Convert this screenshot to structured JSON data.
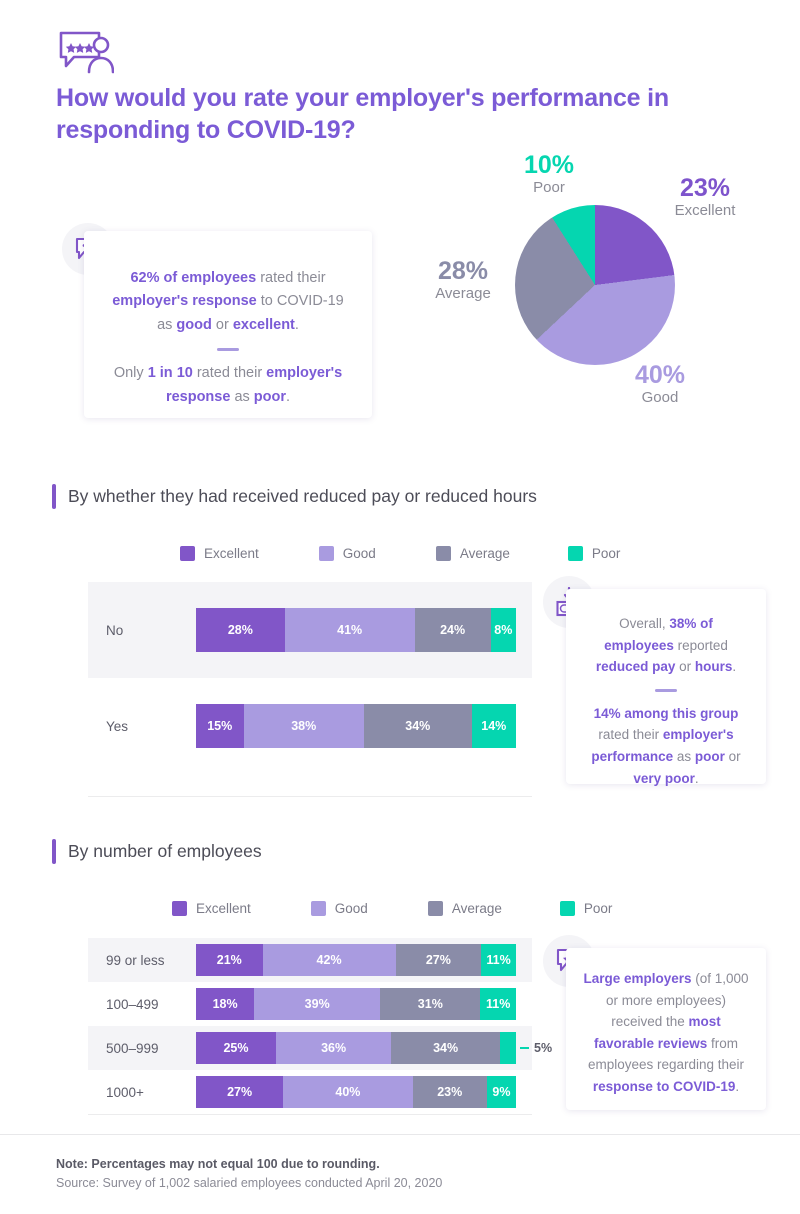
{
  "header": {
    "icon": "review-person-speech-bubble-icon",
    "title": "How would you rate your employer's performance in responding to COVID-19?"
  },
  "colors": {
    "excellent": "#8156c8",
    "good": "#a99be0",
    "average": "#8a8ca8",
    "poor": "#05d6b0",
    "title_purple": "#7b5bd6",
    "text_gray": "#8b8b96",
    "row_alt": "#f4f4f7"
  },
  "pie_labels": {
    "poor": {
      "value": "10%",
      "label": "Poor"
    },
    "excellent": {
      "value": "23%",
      "label": "Excellent"
    },
    "average": {
      "value": "28%",
      "label": "Average"
    },
    "good": {
      "value": "40%",
      "label": "Good"
    }
  },
  "cards": {
    "card1": {
      "icon": "speech-bubble-dots-icon",
      "line1_a": "62% of employees",
      "line1_b": " rated their ",
      "line1_c": "employer's response",
      "line1_d": " to COVID-19 as ",
      "line1_e": "good",
      "line1_f": " or ",
      "line1_g": "excellent",
      "line1_h": ".",
      "line2_a": "Only ",
      "line2_b": "1 in 10",
      "line2_c": " rated their ",
      "line2_d": "employer's response",
      "line2_e": " as ",
      "line2_f": "poor",
      "line2_g": "."
    },
    "card2": {
      "icon": "money-reduced-pay-icon",
      "line1_a": "Overall, ",
      "line1_b": "38% of employees",
      "line1_c": " reported ",
      "line1_d": "reduced pay",
      "line1_e": " or ",
      "line1_f": "hours",
      "line1_g": ".",
      "line2_a": "14% among this group",
      "line2_b": " rated their ",
      "line2_c": "employer's performance",
      "line2_d": " as ",
      "line2_e": "poor",
      "line2_f": " or ",
      "line2_g": "very poor",
      "line2_h": "."
    },
    "card3": {
      "icon": "star-speech-bubble-icon",
      "line1_a": "Large employers",
      "line1_b": " (of 1,000 or more employees) received the ",
      "line1_c": "most favorable reviews",
      "line1_d": " from employees regarding their ",
      "line1_e": "response to COVID-19",
      "line1_f": "."
    }
  },
  "sections": {
    "section1_title": "By whether they had received reduced pay or reduced hours",
    "section2_title": "By number of employees"
  },
  "legend": [
    {
      "label": "Excellent",
      "color": "#8156c8"
    },
    {
      "label": "Good",
      "color": "#a99be0"
    },
    {
      "label": "Average",
      "color": "#8a8ca8"
    },
    {
      "label": "Poor",
      "color": "#05d6b0"
    }
  ],
  "footer": {
    "note": "Note: Percentages may not equal 100 due to rounding.",
    "source": "Source: Survey of 1,002 salaried employees conducted April 20, 2020"
  },
  "chart_data": [
    {
      "type": "pie",
      "title": "How would you rate your employer's performance in responding to COVID-19?",
      "categories": [
        "Excellent",
        "Good",
        "Average",
        "Poor"
      ],
      "values": [
        23,
        40,
        28,
        10
      ],
      "colors": [
        "#8156c8",
        "#a99be0",
        "#8a8ca8",
        "#05d6b0"
      ],
      "labels": [
        "23% Excellent",
        "40% Good",
        "28% Average",
        "10% Poor"
      ],
      "legend": "labels placed around pie"
    },
    {
      "type": "bar",
      "subtype": "stacked-horizontal-100",
      "title": "By whether they had received reduced pay or reduced hours",
      "categories": [
        "No",
        "Yes"
      ],
      "series": [
        {
          "name": "Excellent",
          "color": "#8156c8",
          "values": [
            28,
            15
          ]
        },
        {
          "name": "Good",
          "color": "#a99be0",
          "values": [
            41,
            38
          ]
        },
        {
          "name": "Average",
          "color": "#8a8ca8",
          "values": [
            24,
            34
          ]
        },
        {
          "name": "Poor",
          "color": "#05d6b0",
          "values": [
            8,
            14
          ]
        }
      ],
      "xlabel": "",
      "ylabel": "",
      "xlim": [
        0,
        101
      ],
      "grid": false,
      "legend_position": "top"
    },
    {
      "type": "bar",
      "subtype": "stacked-horizontal-100",
      "title": "By number of employees",
      "categories": [
        "99 or less",
        "100–499",
        "500–999",
        "1000+"
      ],
      "series": [
        {
          "name": "Excellent",
          "color": "#8156c8",
          "values": [
            21,
            18,
            25,
            27
          ]
        },
        {
          "name": "Good",
          "color": "#a99be0",
          "values": [
            42,
            39,
            36,
            40
          ]
        },
        {
          "name": "Average",
          "color": "#8a8ca8",
          "values": [
            27,
            31,
            34,
            23
          ]
        },
        {
          "name": "Poor",
          "color": "#05d6b0",
          "values": [
            11,
            11,
            5,
            9
          ]
        }
      ],
      "annotations": [
        {
          "row": "500–999",
          "series": "Poor",
          "text": "5%",
          "placement": "outside-right-with-leader-line"
        }
      ],
      "xlabel": "",
      "ylabel": "",
      "xlim": [
        0,
        101
      ],
      "grid": false,
      "legend_position": "top"
    }
  ],
  "bars1": [
    {
      "category": "No",
      "segments": [
        {
          "name": "Excellent",
          "value": 28,
          "text": "28%"
        },
        {
          "name": "Good",
          "value": 41,
          "text": "41%"
        },
        {
          "name": "Average",
          "value": 24,
          "text": "24%"
        },
        {
          "name": "Poor",
          "value": 8,
          "text": "8%"
        }
      ]
    },
    {
      "category": "Yes",
      "segments": [
        {
          "name": "Excellent",
          "value": 15,
          "text": "15%"
        },
        {
          "name": "Good",
          "value": 38,
          "text": "38%"
        },
        {
          "name": "Average",
          "value": 34,
          "text": "34%"
        },
        {
          "name": "Poor",
          "value": 14,
          "text": "14%"
        }
      ]
    }
  ],
  "bars2": [
    {
      "category": "99 or less",
      "segments": [
        {
          "name": "Excellent",
          "value": 21,
          "text": "21%"
        },
        {
          "name": "Good",
          "value": 42,
          "text": "42%"
        },
        {
          "name": "Average",
          "value": 27,
          "text": "27%"
        },
        {
          "name": "Poor",
          "value": 11,
          "text": "11%"
        }
      ]
    },
    {
      "category": "100–499",
      "segments": [
        {
          "name": "Excellent",
          "value": 18,
          "text": "18%"
        },
        {
          "name": "Good",
          "value": 39,
          "text": "39%"
        },
        {
          "name": "Average",
          "value": 31,
          "text": "31%"
        },
        {
          "name": "Poor",
          "value": 11,
          "text": "11%"
        }
      ]
    },
    {
      "category": "500–999",
      "segments": [
        {
          "name": "Excellent",
          "value": 25,
          "text": "25%"
        },
        {
          "name": "Good",
          "value": 36,
          "text": "36%"
        },
        {
          "name": "Average",
          "value": 34,
          "text": "34%"
        },
        {
          "name": "Poor",
          "value": 5,
          "text": ""
        }
      ],
      "external_label": "5%"
    },
    {
      "category": "1000+",
      "segments": [
        {
          "name": "Excellent",
          "value": 27,
          "text": "27%"
        },
        {
          "name": "Good",
          "value": 40,
          "text": "40%"
        },
        {
          "name": "Average",
          "value": 23,
          "text": "23%"
        },
        {
          "name": "Poor",
          "value": 9,
          "text": "9%"
        }
      ]
    }
  ]
}
